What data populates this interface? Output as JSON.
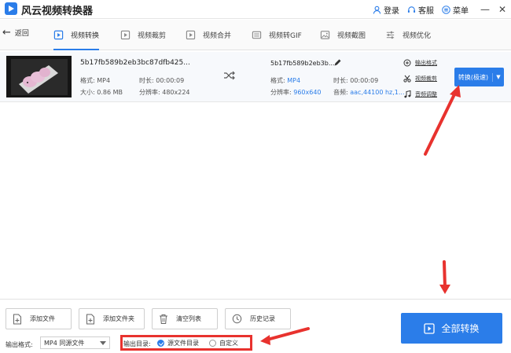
{
  "app": {
    "title": "风云视频转换器"
  },
  "title_actions": {
    "login": "登录",
    "service": "客服",
    "menu": "菜单",
    "minimize": "—",
    "close": "✕"
  },
  "nav": {
    "back_label": "返回",
    "tabs": [
      {
        "label": "视频转换",
        "icon": "play-square-icon"
      },
      {
        "label": "视频裁剪",
        "icon": "crop-icon"
      },
      {
        "label": "视频合并",
        "icon": "merge-icon"
      },
      {
        "label": "视频转GIF",
        "icon": "gif-icon"
      },
      {
        "label": "视频截图",
        "icon": "image-icon"
      },
      {
        "label": "视频优化",
        "icon": "sliders-icon"
      }
    ]
  },
  "file": {
    "source_name": "5b17fb589b2eb3bc87dfb425...",
    "format_label": "格式: MP4",
    "duration_label": "时长: 00:00:09",
    "size_label": "大小: 0.86 MB",
    "resolution_label": "分辨率: 480x224",
    "output_name": "5b17fb589b2eb3b...",
    "out_format_key": "格式:",
    "out_format_val": "MP4",
    "out_duration_label": "时长: 00:00:09",
    "out_resolution_key": "分辨率:",
    "out_resolution_val": "960x640",
    "out_audio_key": "音频:",
    "out_audio_val": "aac,44100 hz,1...",
    "options": {
      "output_format": "输出格式",
      "video_crop": "视频裁剪",
      "audio_adjust": "音频调整"
    },
    "convert_label": "转换(极速)"
  },
  "bottom": {
    "add_file": "添加文件",
    "add_folder": "添加文件夹",
    "clear_list": "清空列表",
    "history": "历史记录",
    "output_format_label": "输出格式:",
    "output_format_value": "MP4 同源文件",
    "output_dir_label": "输出目录:",
    "dir_source": "源文件目录",
    "dir_custom": "自定义",
    "convert_all": "全部转换"
  },
  "colors": {
    "accent": "#2b7de9",
    "annotation": "#e8322e"
  }
}
